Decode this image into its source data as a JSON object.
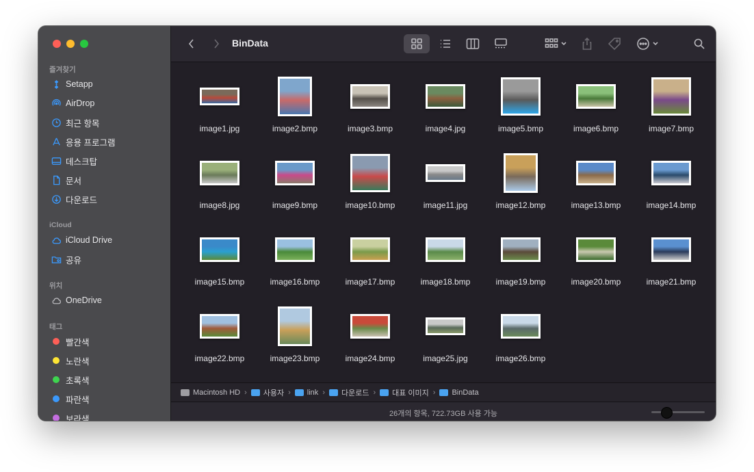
{
  "toolbar": {
    "title": "BinData"
  },
  "sidebar": {
    "favorites_header": "즐겨찾기",
    "favorites": [
      {
        "label": "Setapp",
        "icon": "setapp-icon"
      },
      {
        "label": "AirDrop",
        "icon": "airdrop-icon"
      },
      {
        "label": "최근 항목",
        "icon": "clock-icon"
      },
      {
        "label": "응용 프로그램",
        "icon": "applications-icon"
      },
      {
        "label": "데스크탑",
        "icon": "desktop-icon"
      },
      {
        "label": "문서",
        "icon": "document-icon"
      },
      {
        "label": "다운로드",
        "icon": "download-icon"
      }
    ],
    "icloud_header": "iCloud",
    "icloud": [
      {
        "label": "iCloud Drive",
        "icon": "cloud-icon"
      },
      {
        "label": "공유",
        "icon": "shared-folder-icon"
      }
    ],
    "locations_header": "위치",
    "locations": [
      {
        "label": "OneDrive",
        "icon": "cloud-icon"
      }
    ],
    "tags_header": "태그",
    "tags": [
      {
        "label": "빨간색",
        "color": "#fe5f57"
      },
      {
        "label": "노란색",
        "color": "#fee534"
      },
      {
        "label": "초록색",
        "color": "#3ed44f"
      },
      {
        "label": "파란색",
        "color": "#3b99fc"
      },
      {
        "label": "보라색",
        "color": "#c46ee0"
      }
    ]
  },
  "files": [
    {
      "name": "image1.jpg",
      "orient": "wide",
      "colors": [
        "#7a6a5a",
        "#b84a3a",
        "#3a6aa0"
      ]
    },
    {
      "name": "image2.bmp",
      "orient": "tall",
      "colors": [
        "#7fa6cc",
        "#c86a6a",
        "#4a78b0"
      ]
    },
    {
      "name": "image3.bmp",
      "orient": "land",
      "colors": [
        "#c9c3b6",
        "#55504a",
        "#8a8580"
      ]
    },
    {
      "name": "image4.jpg",
      "orient": "land",
      "colors": [
        "#6a8a60",
        "#8a6040",
        "#3a5a3a"
      ]
    },
    {
      "name": "image5.bmp",
      "orient": "square",
      "colors": [
        "#9a9a9a",
        "#5a5a5a",
        "#2ea6e8"
      ]
    },
    {
      "name": "image6.bmp",
      "orient": "land",
      "colors": [
        "#8ac07a",
        "#4a7a3a",
        "#c9c3a6"
      ]
    },
    {
      "name": "image7.bmp",
      "orient": "square",
      "colors": [
        "#c9b08a",
        "#7a4a8a",
        "#6a8a3a"
      ]
    },
    {
      "name": "image8.jpg",
      "orient": "land",
      "colors": [
        "#9ab07a",
        "#6a7a5a",
        "#c9c9c9"
      ]
    },
    {
      "name": "image9.bmp",
      "orient": "land",
      "colors": [
        "#6a9ac9",
        "#c94a8a",
        "#8a7a6a"
      ]
    },
    {
      "name": "image10.bmp",
      "orient": "square",
      "colors": [
        "#8a9ab0",
        "#c94a4a",
        "#3a7a5a"
      ]
    },
    {
      "name": "image11.jpg",
      "orient": "wide",
      "colors": [
        "#c9c9c9",
        "#8a8a8a",
        "#6a7a8a"
      ]
    },
    {
      "name": "image12.bmp",
      "orient": "tall",
      "colors": [
        "#c9a05a",
        "#7a6a5a",
        "#aac9e8"
      ]
    },
    {
      "name": "image13.bmp",
      "orient": "land",
      "colors": [
        "#5a8ac9",
        "#8a6a4a",
        "#c9b08a"
      ]
    },
    {
      "name": "image14.bmp",
      "orient": "land",
      "colors": [
        "#6a9ad0",
        "#2a4a6a",
        "#c9c9d0"
      ]
    },
    {
      "name": "image15.bmp",
      "orient": "land",
      "colors": [
        "#3a8ac9",
        "#2aa0d0",
        "#5a8a3a"
      ]
    },
    {
      "name": "image16.bmp",
      "orient": "land",
      "colors": [
        "#9ac0e0",
        "#4a8a3a",
        "#7ab05a"
      ]
    },
    {
      "name": "image17.bmp",
      "orient": "land",
      "colors": [
        "#c9d0a0",
        "#7a9a4a",
        "#c9a050"
      ]
    },
    {
      "name": "image18.bmp",
      "orient": "land",
      "colors": [
        "#c9d9e8",
        "#5a8a4a",
        "#8ab06a"
      ]
    },
    {
      "name": "image19.bmp",
      "orient": "land",
      "colors": [
        "#a0b0c0",
        "#5a4a3a",
        "#6a8a4a"
      ]
    },
    {
      "name": "image20.bmp",
      "orient": "land",
      "colors": [
        "#5a8a3a",
        "#c9c9b0",
        "#3a6a2a"
      ]
    },
    {
      "name": "image21.bmp",
      "orient": "land",
      "colors": [
        "#5a90d0",
        "#2a3a5a",
        "#c9c9c9"
      ]
    },
    {
      "name": "image22.bmp",
      "orient": "land",
      "colors": [
        "#a0c0e0",
        "#a05a3a",
        "#5a8a3a"
      ]
    },
    {
      "name": "image23.bmp",
      "orient": "tall",
      "colors": [
        "#b0c9e0",
        "#c9a05a",
        "#6a8a5a"
      ]
    },
    {
      "name": "image24.bmp",
      "orient": "land",
      "colors": [
        "#c94a3a",
        "#6a8a4a",
        "#c9c0b0"
      ]
    },
    {
      "name": "image25.jpg",
      "orient": "wide",
      "colors": [
        "#c9c9c9",
        "#5a6a5a",
        "#8a9a6a"
      ]
    },
    {
      "name": "image26.bmp",
      "orient": "land",
      "colors": [
        "#c9d9e8",
        "#5a6a6a",
        "#6a8a5a"
      ]
    }
  ],
  "pathbar": [
    "Macintosh HD",
    "사용자",
    "link",
    "다운로드",
    "대표 이미지",
    "BinData"
  ],
  "status": {
    "text": "26개의 항목, 722.73GB 사용 가능",
    "zoom": 0.28
  }
}
